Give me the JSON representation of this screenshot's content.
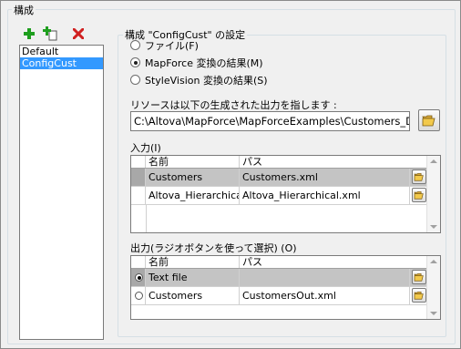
{
  "outer_group": {
    "title": "構成"
  },
  "toolbar": {
    "add_icon": "plus-icon",
    "copy_icon": "copy-add-icon",
    "delete_icon": "delete-x-icon"
  },
  "config_list": {
    "items": [
      "Default",
      "ConfigCust"
    ],
    "selected": "ConfigCust"
  },
  "settings_group": {
    "title": "構成 \"ConfigCust\" の設定"
  },
  "radios": [
    {
      "label": "ファイル(F)",
      "checked": false
    },
    {
      "label": "MapForce 変換の結果(M)",
      "checked": true
    },
    {
      "label": "StyleVision 変換の結果(S)",
      "checked": false
    }
  ],
  "resource": {
    "label": "リソースは以下の生成された出力を指します :",
    "value": "C:\\Altova\\MapForce\\MapForceExamples\\Customers_DB.mfd"
  },
  "input_grid": {
    "label": "入力(I)",
    "headers": {
      "name": "名前",
      "path": "パス"
    },
    "rows": [
      {
        "name": "Customers",
        "path": "Customers.xml"
      },
      {
        "name": "Altova_Hierarchical",
        "path": "Altova_Hierarchical.xml"
      }
    ]
  },
  "output_grid": {
    "label": "出力(ラジオボタンを使って選択) (O)",
    "headers": {
      "name": "名前",
      "path": "パス"
    },
    "rows": [
      {
        "name": "Text file",
        "path": "",
        "selected": true
      },
      {
        "name": "Customers",
        "path": "CustomersOut.xml",
        "selected": false
      }
    ]
  },
  "colors": {
    "selection": "#3399ff",
    "row_highlight": "#c4c4c4",
    "add_green": "#1e9e1e",
    "delete_red": "#d02020",
    "folder_yellow": "#f2c94c"
  }
}
